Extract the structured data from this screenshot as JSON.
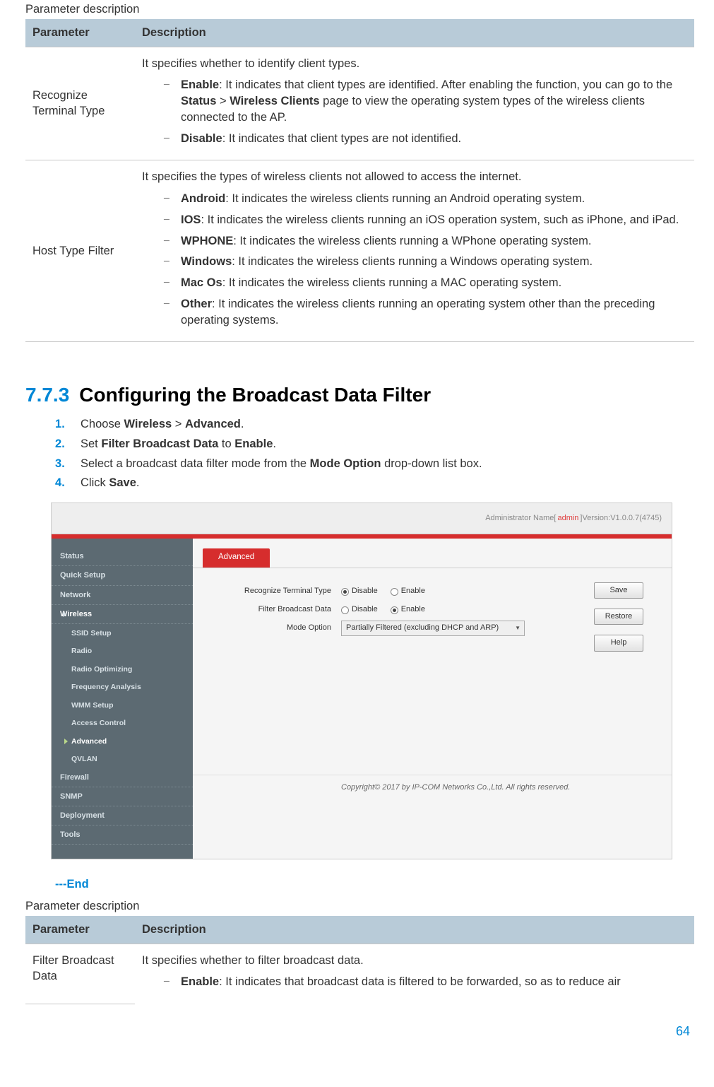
{
  "table1": {
    "title": "Parameter description",
    "head_param": "Parameter",
    "head_desc": "Description",
    "rows": [
      {
        "param": "Recognize Terminal Type",
        "intro": "It specifies whether to identify client types.",
        "items": [
          {
            "term": "Enable",
            "text": ": It indicates that client types are identified. After enabling the function, you can go to the ",
            "mid1": "Status",
            "mid2": " > ",
            "mid3": "Wireless Clients",
            "tail": " page to view the operating system types of the wireless clients connected to the AP."
          },
          {
            "term": "Disable",
            "text": ": It indicates that client types are not identified."
          }
        ]
      },
      {
        "param": "Host Type Filter",
        "intro": "It specifies the types of wireless clients not allowed to access the internet.",
        "items": [
          {
            "term": "Android",
            "text": ": It indicates the wireless clients running an Android operating system."
          },
          {
            "term": "IOS",
            "text": ": It indicates the wireless clients running an iOS operation system, such as iPhone, and iPad."
          },
          {
            "term": "WPHONE",
            "text": ": It indicates the wireless clients running a WPhone operating system."
          },
          {
            "term": "Windows",
            "text": ": It indicates the wireless clients running a Windows operating system."
          },
          {
            "term": "Mac Os",
            "text": ": It indicates the wireless clients running a MAC operating system."
          },
          {
            "term": "Other",
            "text": ": It indicates the wireless clients running an operating system other than the preceding operating systems."
          }
        ]
      }
    ]
  },
  "section": {
    "num": "7.7.3",
    "title": "Configuring the Broadcast Data Filter",
    "steps": [
      {
        "pre": "Choose ",
        "b1": "Wireless",
        "mid": " > ",
        "b2": "Advanced",
        "post": "."
      },
      {
        "pre": "Set ",
        "b1": "Filter Broadcast Data",
        "mid": " to ",
        "b2": "Enable",
        "post": "."
      },
      {
        "pre": "Select a broadcast data filter mode from the ",
        "b1": "Mode Option",
        "mid": "",
        "b2": "",
        "post": " drop-down list box."
      },
      {
        "pre": "Click ",
        "b1": "Save",
        "mid": "",
        "b2": "",
        "post": "."
      }
    ]
  },
  "shot": {
    "top_prefix": "Administrator Name[",
    "top_admin": "admin",
    "top_suffix": "]Version:V1.0.0.7(4745)",
    "side": {
      "items": [
        "Status",
        "Quick Setup",
        "Network",
        "Wireless"
      ],
      "subs": [
        "SSID Setup",
        "Radio",
        "Radio Optimizing",
        "Frequency Analysis",
        "WMM Setup",
        "Access Control",
        "Advanced",
        "QVLAN"
      ],
      "items2": [
        "Firewall",
        "SNMP",
        "Deployment",
        "Tools"
      ]
    },
    "tab": "Advanced",
    "form": {
      "rtt_label": "Recognize Terminal Type",
      "fbd_label": "Filter Broadcast Data",
      "mode_label": "Mode Option",
      "opt_disable": "Disable",
      "opt_enable": "Enable",
      "mode_value": "Partially Filtered (excluding DHCP and ARP)"
    },
    "buttons": {
      "save": "Save",
      "restore": "Restore",
      "help": "Help"
    },
    "footer": "Copyright© 2017 by IP-COM Networks Co.,Ltd. All rights reserved."
  },
  "end_marker": "---End",
  "table2": {
    "title": "Parameter description",
    "head_param": "Parameter",
    "head_desc": "Description",
    "row": {
      "param": "Filter Broadcast Data",
      "intro": "It specifies whether to filter broadcast data.",
      "item_term": "Enable",
      "item_text": ": It indicates that broadcast data is filtered to be forwarded, so as to reduce air"
    }
  },
  "page_num": "64"
}
